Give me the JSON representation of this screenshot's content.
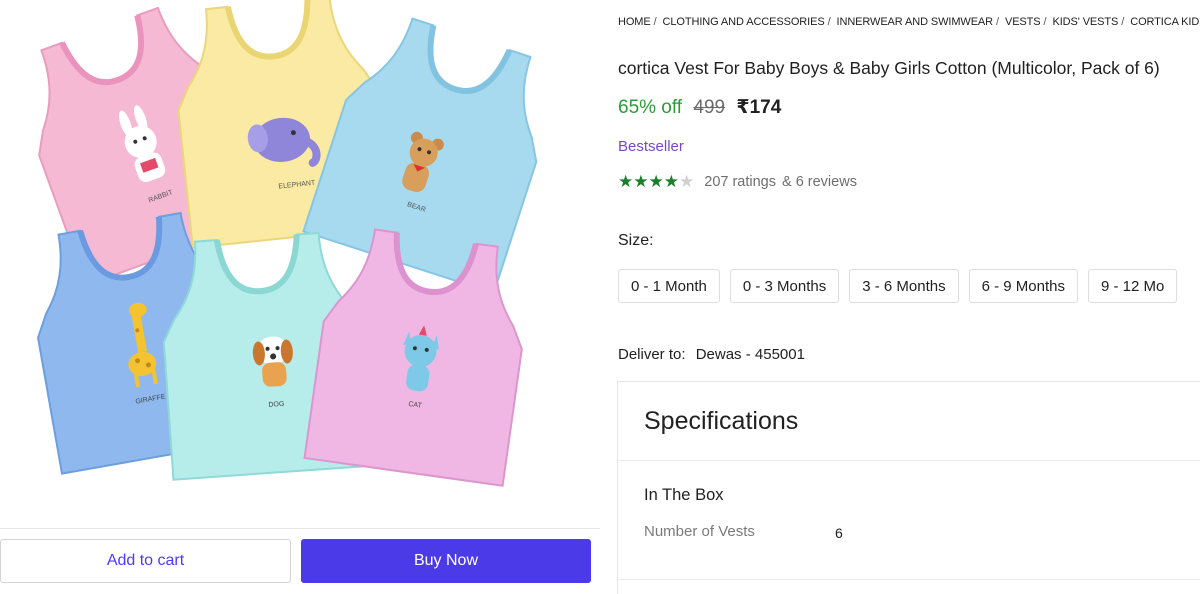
{
  "breadcrumb": [
    "HOME",
    "CLOTHING AND ACCESSORIES",
    "INNERWEAR AND SWIMWEAR",
    "VESTS",
    "KIDS' VESTS",
    "CORTICA KIDS' VE"
  ],
  "product": {
    "title": "cortica Vest For Baby Boys & Baby Girls Cotton (Multicolor, Pack of 6)",
    "discount": "65% off",
    "mrp": "499",
    "price": "₹174",
    "badge": "Bestseller",
    "rating_value": 4,
    "rating_max": 5,
    "ratings_text": "207 ratings",
    "reviews_text": "& 6 reviews",
    "image_labels": [
      "RABBIT",
      "ELEPHANT",
      "BEAR",
      "GIRAFFE",
      "DOG",
      "CAT"
    ]
  },
  "size": {
    "label": "Size:",
    "options": [
      "0 - 1 Month",
      "0 - 3 Months",
      "3 - 6 Months",
      "6 - 9 Months",
      "9 - 12 Mo"
    ]
  },
  "delivery": {
    "label": "Deliver to:",
    "location": "Dewas - 455001"
  },
  "specifications": {
    "title": "Specifications",
    "group": "In The Box",
    "key": "Number of Vests",
    "value": "6"
  },
  "actions": {
    "add_to_cart": "Add to cart",
    "buy_now": "Buy Now"
  },
  "colors": {
    "accent": "#4b3ae8",
    "discount": "#2d9b3a",
    "badge": "#7b47c7",
    "star": "#1a7f2b"
  }
}
